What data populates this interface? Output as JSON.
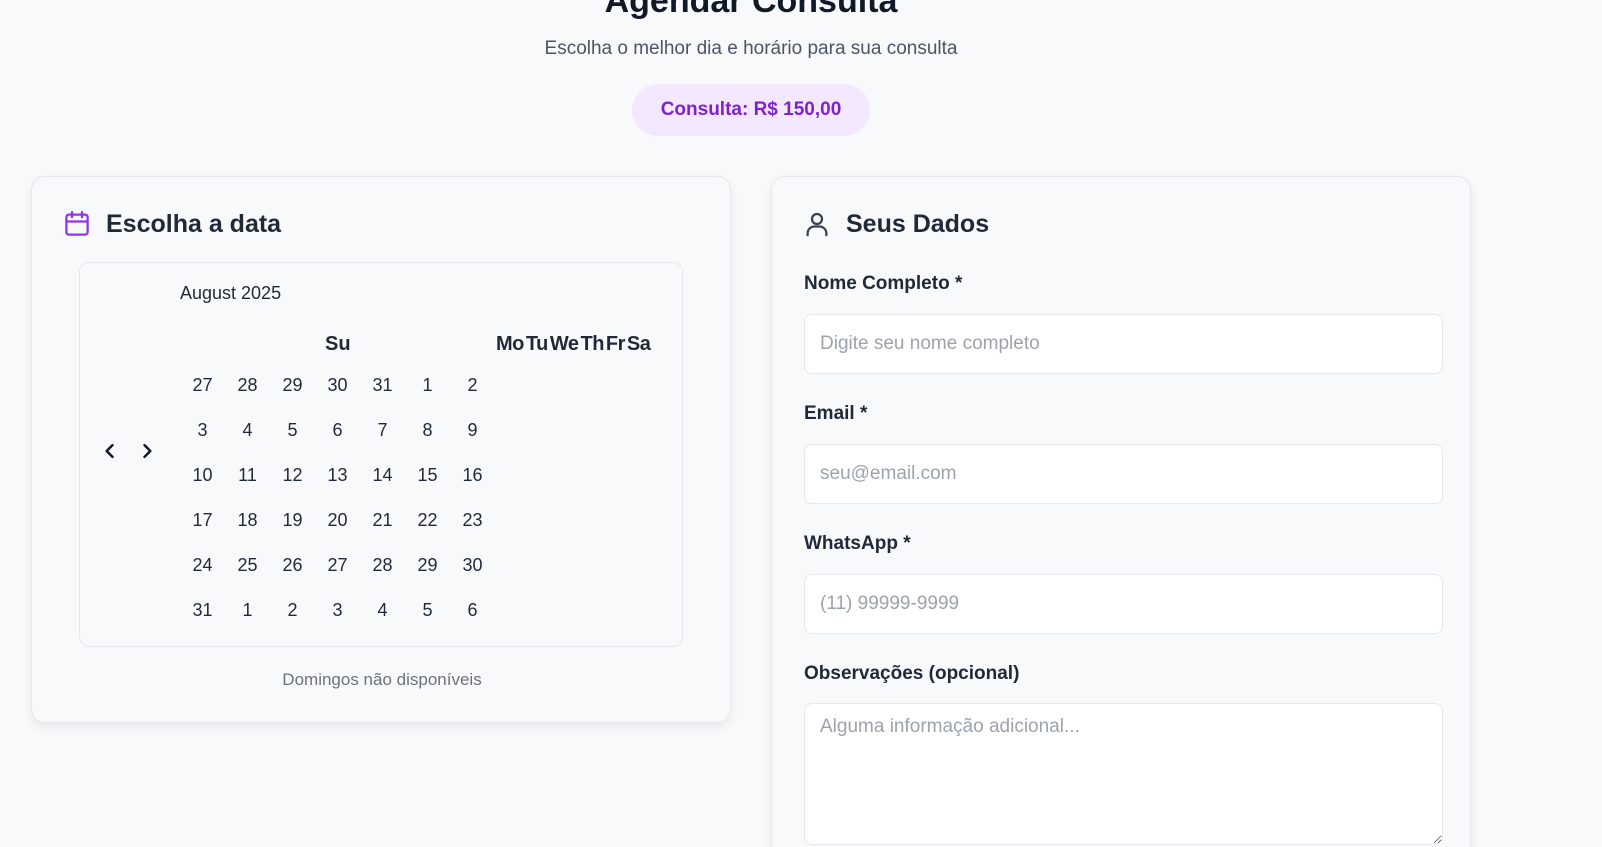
{
  "header": {
    "title": "Agendar Consulta",
    "subtitle": "Escolha o melhor dia e horário para sua consulta",
    "price_badge": "Consulta: R$ 150,00"
  },
  "date_card": {
    "title": "Escolha a data",
    "icon": "calendar-icon",
    "calendar": {
      "month": "August 2025",
      "weekday_first": "Su",
      "weekdays_rest": [
        "Mo",
        "Tu",
        "We",
        "Th",
        "Fr",
        "Sa"
      ],
      "days": [
        [
          "27",
          "28",
          "29",
          "30",
          "31",
          "1",
          "2"
        ],
        [
          "3",
          "4",
          "5",
          "6",
          "7",
          "8",
          "9"
        ],
        [
          "10",
          "11",
          "12",
          "13",
          "14",
          "15",
          "16"
        ],
        [
          "17",
          "18",
          "19",
          "20",
          "21",
          "22",
          "23"
        ],
        [
          "24",
          "25",
          "26",
          "27",
          "28",
          "29",
          "30"
        ],
        [
          "31",
          "1",
          "2",
          "3",
          "4",
          "5",
          "6"
        ]
      ]
    },
    "note": "Domingos não disponíveis"
  },
  "data_card": {
    "title": "Seus Dados",
    "icon": "user-icon",
    "fields": {
      "name": {
        "label": "Nome Completo *",
        "placeholder": "Digite seu nome completo",
        "value": ""
      },
      "email": {
        "label": "Email *",
        "placeholder": "seu@email.com",
        "value": ""
      },
      "whatsapp": {
        "label": "WhatsApp *",
        "placeholder": "(11) 99999-9999",
        "value": ""
      },
      "notes": {
        "label": "Observações (opcional)",
        "placeholder": "Alguma informação adicional...",
        "value": ""
      }
    }
  },
  "colors": {
    "accent": "#7e22ce",
    "badge_bg": "#f3e8ff",
    "background": "#f8f9fb"
  }
}
